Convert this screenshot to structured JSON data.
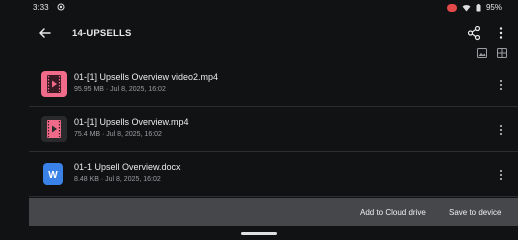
{
  "status": {
    "time": "3:33",
    "battery": "95%"
  },
  "header": {
    "title": "14-UPSELLS"
  },
  "files": [
    {
      "name": "01-[1] Upsells Overview video2.mp4",
      "meta": "95.95 MB · Jul 8, 2025, 16:02",
      "icon": "video-file-icon"
    },
    {
      "name": "01-[1] Upsells Overview.mp4",
      "meta": "75.4 MB · Jul 8, 2025, 16:02",
      "icon": "video-file-icon"
    },
    {
      "name": "01-1 Upsell Overview.docx",
      "meta": "8.48 KB · Jul 8, 2025, 16:02",
      "icon": "word-doc-icon"
    }
  ],
  "actions": {
    "cloud": "Add to Cloud drive",
    "device": "Save to device"
  },
  "colors": {
    "video_icon": "#f06b8a",
    "doc_icon": "#3b82e8",
    "bar": "#46474a"
  }
}
